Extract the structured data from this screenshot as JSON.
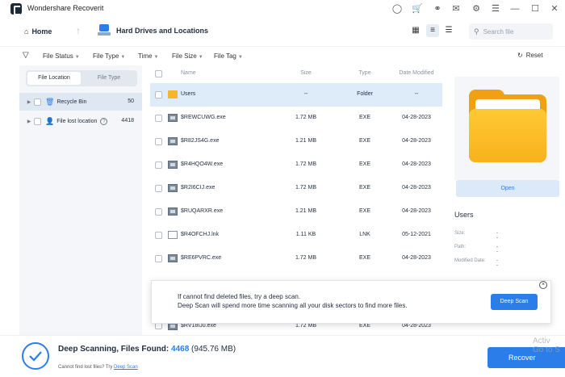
{
  "app": {
    "title": "Wondershare Recoverit"
  },
  "titlebar": {
    "icons": [
      "user-icon",
      "cart-icon",
      "headset-icon",
      "mail-icon",
      "settings-icon",
      "menu-icon",
      "minimize-icon",
      "maximize-icon",
      "close-icon"
    ]
  },
  "nav": {
    "home_label": "Home",
    "breadcrumb": "Hard Drives and Locations",
    "search_placeholder": "Search file"
  },
  "filters": {
    "items": [
      "File Status",
      "File Type",
      "Time",
      "File Size",
      "File Tag"
    ],
    "reset_label": "Reset"
  },
  "left_panel": {
    "tabs": [
      "File Location",
      "File Type"
    ],
    "active_tab": "File Location",
    "tree": [
      {
        "label": "Recycle Bin",
        "count": "50"
      },
      {
        "label": "File lost location",
        "count": "4418"
      }
    ]
  },
  "table": {
    "headers": {
      "name": "Name",
      "size": "Size",
      "type": "Type",
      "date": "Date Modified"
    },
    "rows": [
      {
        "name": "Users",
        "size": "--",
        "type": "Folder",
        "date": "--",
        "icon": "folder-icon"
      },
      {
        "name": "$REWCUWG.exe",
        "size": "1.72 MB",
        "type": "EXE",
        "date": "04-28-2023",
        "icon": "exe-file-icon"
      },
      {
        "name": "$R82JS4G.exe",
        "size": "1.21 MB",
        "type": "EXE",
        "date": "04-28-2023",
        "icon": "exe-file-icon"
      },
      {
        "name": "$R4HQO4W.exe",
        "size": "1.72 MB",
        "type": "EXE",
        "date": "04-28-2023",
        "icon": "exe-file-icon"
      },
      {
        "name": "$R2I6CIJ.exe",
        "size": "1.72 MB",
        "type": "EXE",
        "date": "04-28-2023",
        "icon": "exe-file-icon"
      },
      {
        "name": "$RUQARXR.exe",
        "size": "1.21 MB",
        "type": "EXE",
        "date": "04-28-2023",
        "icon": "exe-file-icon"
      },
      {
        "name": "$R4OFCHJ.lnk",
        "size": "1.11 KB",
        "type": "LNK",
        "date": "05-12-2021",
        "icon": "lnk-file-icon"
      },
      {
        "name": "$RE6PVRC.exe",
        "size": "1.72 MB",
        "type": "EXE",
        "date": "04-28-2023",
        "icon": "exe-file-icon"
      },
      {
        "name": "$RV18IJ0.exe",
        "size": "1.72 MB",
        "type": "EXE",
        "date": "04-28-2023",
        "icon": "exe-file-icon"
      }
    ]
  },
  "preview": {
    "open_label": "Open",
    "title": "Users",
    "meta": [
      {
        "label": "Size:",
        "value": "--"
      },
      {
        "label": "Path:",
        "value": "--"
      },
      {
        "label": "Modified Date:",
        "value": "--"
      }
    ]
  },
  "popup": {
    "line1": "If cannot find deleted files, try a deep scan.",
    "line2": "Deep Scan will spend more time scanning all your disk sectors to find more files.",
    "button": "Deep Scan",
    "close": "×"
  },
  "bottom": {
    "status_prefix": "Deep Scanning, Files Found:",
    "count": "4468",
    "size": "(945.76 MB)",
    "hint_prefix": "Cannot find lost files? Try",
    "hint_link": "Deep Scan",
    "recover_label": "Recover"
  },
  "watermark": {
    "line1": "Activ",
    "line2": "Go to S"
  },
  "colors": {
    "accent": "#2b7de9",
    "folder": "#f5b62a",
    "selected_row": "#deebf9"
  }
}
